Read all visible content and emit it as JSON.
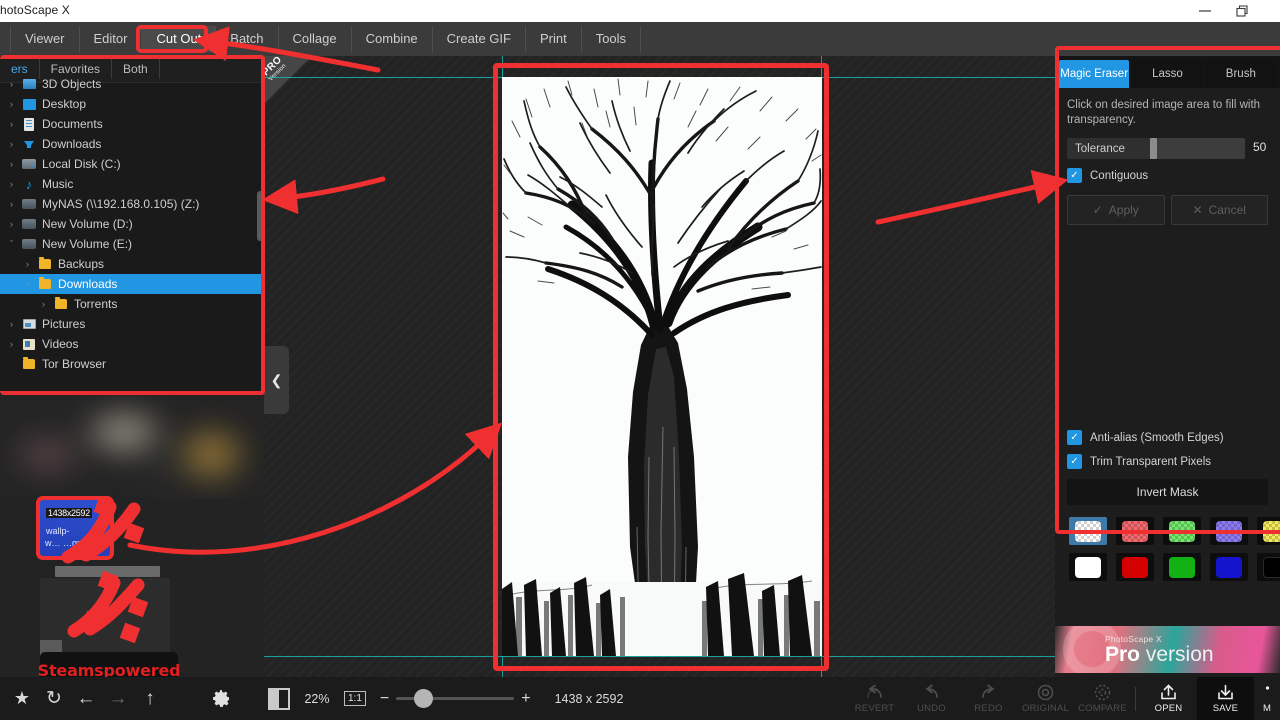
{
  "window": {
    "title": "hotoScape X",
    "controls": [
      {
        "name": "minimize",
        "glyph": "minimize-icon"
      },
      {
        "name": "restore",
        "glyph": "restore-icon"
      }
    ]
  },
  "menubar": {
    "items": [
      {
        "label": "Viewer",
        "active": false
      },
      {
        "label": "Editor",
        "active": false
      },
      {
        "label": "Cut Out",
        "active": true
      },
      {
        "label": "Batch",
        "active": false
      },
      {
        "label": "Collage",
        "active": false
      },
      {
        "label": "Combine",
        "active": false
      },
      {
        "label": "Create GIF",
        "active": false
      },
      {
        "label": "Print",
        "active": false
      },
      {
        "label": "Tools",
        "active": false
      }
    ]
  },
  "sidebar": {
    "tabs": [
      {
        "label": "ers",
        "active": true
      },
      {
        "label": "Favorites",
        "active": false
      },
      {
        "label": "Both",
        "active": false
      }
    ],
    "tree": [
      {
        "label": "3D Objects",
        "icon": "cube-icon",
        "indent": 0,
        "arrow": "›",
        "selected": false
      },
      {
        "label": "Desktop",
        "icon": "desktop-icon",
        "indent": 0,
        "arrow": "›",
        "selected": false
      },
      {
        "label": "Documents",
        "icon": "document-icon",
        "indent": 0,
        "arrow": "›",
        "selected": false
      },
      {
        "label": "Downloads",
        "icon": "download-icon",
        "indent": 0,
        "arrow": "›",
        "selected": false
      },
      {
        "label": "Local Disk (C:)",
        "icon": "drive-icon",
        "indent": 0,
        "arrow": "›",
        "selected": false
      },
      {
        "label": "Music",
        "icon": "music-note-icon",
        "indent": 0,
        "arrow": "›",
        "selected": false
      },
      {
        "label": "MyNAS (\\\\192.168.0.105) (Z:)",
        "icon": "network-drive-icon",
        "indent": 0,
        "arrow": "›",
        "selected": false
      },
      {
        "label": "New Volume (D:)",
        "icon": "drive-icon",
        "indent": 0,
        "arrow": "›",
        "selected": false
      },
      {
        "label": "New Volume (E:)",
        "icon": "drive-icon",
        "indent": 0,
        "arrow": "ˇ",
        "selected": false
      },
      {
        "label": "Backups",
        "icon": "folder-icon",
        "indent": 1,
        "arrow": "›",
        "selected": false
      },
      {
        "label": "Downloads",
        "icon": "folder-icon",
        "indent": 1,
        "arrow": "›",
        "selected": true
      },
      {
        "label": "Torrents",
        "icon": "folder-icon",
        "indent": 2,
        "arrow": "›",
        "selected": false
      },
      {
        "label": "Pictures",
        "icon": "pictures-icon",
        "indent": 0,
        "arrow": "›",
        "selected": false
      },
      {
        "label": "Videos",
        "icon": "videos-icon",
        "indent": 0,
        "arrow": "›",
        "selected": false
      },
      {
        "label": "Tor Browser",
        "icon": "folder-icon",
        "indent": 0,
        "arrow": "",
        "selected": false
      }
    ]
  },
  "thumbnail": {
    "dimension_label": "1438x2592",
    "name_line1": "wallp-",
    "name_line2": "w… …gr…",
    "watermark": "Steamspowered"
  },
  "canvas": {
    "pro_ribbon": "PRO",
    "pro_ribbon_sub": "Version",
    "collapse_icon": "chevron-left-icon"
  },
  "right_panel": {
    "tabs": [
      {
        "label": "Magic Eraser",
        "active": true
      },
      {
        "label": "Lasso",
        "active": false
      },
      {
        "label": "Brush",
        "active": false
      }
    ],
    "hint": "Click on desired image area to fill with transparency.",
    "tolerance": {
      "label": "Tolerance",
      "value": "50"
    },
    "contiguous": {
      "label": "Contiguous",
      "checked": true
    },
    "apply_label": "Apply",
    "cancel_label": "Cancel",
    "antialias": {
      "label": "Anti-alias (Smooth Edges)",
      "checked": true
    },
    "trim": {
      "label": "Trim Transparent Pixels",
      "checked": true
    },
    "invert_mask": "Invert Mask",
    "swatches_row1": [
      "transparent",
      "#f2696e",
      "#72e86a",
      "#8a7bf0",
      "#f2e85a"
    ],
    "swatches_row2": [
      "#ffffff",
      "#d40000",
      "#12b215",
      "#1414cc",
      "#000000"
    ],
    "promo": {
      "small": "PhotoScape X",
      "big_bold": "Pro",
      "big_light": " version"
    }
  },
  "bottom_bar": {
    "left_icons": [
      {
        "name": "favorite-star-icon",
        "glyph": "★",
        "dim": false
      },
      {
        "name": "refresh-icon",
        "glyph": "↻",
        "dim": false
      },
      {
        "name": "back-arrow-icon",
        "glyph": "←",
        "dim": false
      },
      {
        "name": "forward-arrow-icon",
        "glyph": "→",
        "dim": true
      },
      {
        "name": "up-arrow-icon",
        "glyph": "↑",
        "dim": false
      }
    ],
    "settings_icon": "gear-icon",
    "zoom_percent": "22%",
    "one_to_one": "1:1",
    "image_dimensions": "1438 x 2592",
    "actions": [
      {
        "label": "REVERT",
        "icon": "revert-icon",
        "enabled": false
      },
      {
        "label": "UNDO",
        "icon": "undo-icon",
        "enabled": false
      },
      {
        "label": "REDO",
        "icon": "redo-icon",
        "enabled": false
      },
      {
        "label": "ORIGINAL",
        "icon": "original-circle-icon",
        "enabled": false
      },
      {
        "label": "COMPARE",
        "icon": "compare-circle-icon",
        "enabled": false
      },
      {
        "label": "OPEN",
        "icon": "open-upload-icon",
        "enabled": true
      },
      {
        "label": "SAVE",
        "icon": "save-download-icon",
        "enabled": true
      },
      {
        "label": "M",
        "icon": "more-icon",
        "enabled": true
      }
    ]
  },
  "annotations": {
    "color": "#f03030",
    "highlight_boxes": [
      "cut-out-tab",
      "folder-sidebar",
      "magic-eraser-panel",
      "canvas-image"
    ],
    "arrows": 4
  }
}
